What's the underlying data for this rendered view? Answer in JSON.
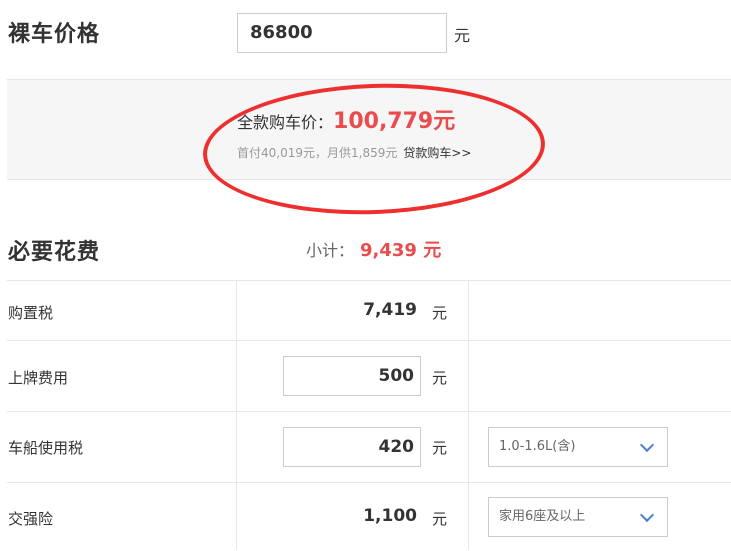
{
  "price_section": {
    "title": "裸车价格",
    "input_value": "86800",
    "unit": "元"
  },
  "summary": {
    "total_label": "全款购车价：",
    "total_value": "100,779元",
    "detail": "首付40,019元，月供1,859元",
    "loan_link": "贷款购车>>"
  },
  "required": {
    "title": "必要花费",
    "subtotal_label": "小计：",
    "subtotal_value": "9,439 元",
    "rows": [
      {
        "label": "购置税",
        "value": "7,419",
        "unit": "元"
      },
      {
        "label": "上牌费用",
        "value": "500",
        "unit": "元"
      },
      {
        "label": "车船使用税",
        "value": "420",
        "unit": "元",
        "select": "1.0-1.6L(含)"
      },
      {
        "label": "交强险",
        "value": "1,100",
        "unit": "元",
        "select": "家用6座及以上"
      }
    ]
  },
  "colors": {
    "accent_red": "#e94c4c",
    "highlight_ring": "#ee2f2f",
    "chevron_blue": "#4a7fd0"
  }
}
